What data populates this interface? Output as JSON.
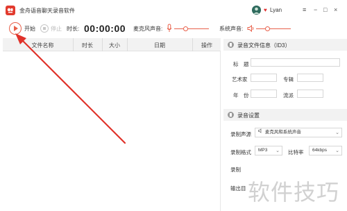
{
  "app": {
    "title": "金舟语音聊天录音软件",
    "user": "Lyan",
    "window_controls": [
      "≡",
      "−",
      "□",
      "×"
    ]
  },
  "toolbar": {
    "start_label": "开始",
    "stop_label": "停止",
    "duration_label": "时长:",
    "duration_value": "00:00:00",
    "mic_label": "麦克风声音:",
    "system_label": "系统声音:"
  },
  "file_table": {
    "columns": [
      "文件名称",
      "时长",
      "大小",
      "日期",
      "操作"
    ]
  },
  "id3_section": {
    "title": "录音文件信息（ID3）",
    "fields": {
      "title": "标　题",
      "artist": "艺术家",
      "album": "专辑",
      "year": "年　份",
      "genre": "流派"
    }
  },
  "record_settings": {
    "title": "录音设置",
    "source_label": "录制声源",
    "source_value": "麦克风和系统声音",
    "format_label": "录制格式",
    "format_value": "MP3",
    "bitrate_label": "比特率",
    "bitrate_value": "64kbps",
    "record_label": "录制",
    "output_label": "输出目"
  },
  "watermark": "软件技巧",
  "colors": {
    "accent": "#e8604a",
    "brand": "#e23b2e",
    "arrow": "#e0322a"
  }
}
